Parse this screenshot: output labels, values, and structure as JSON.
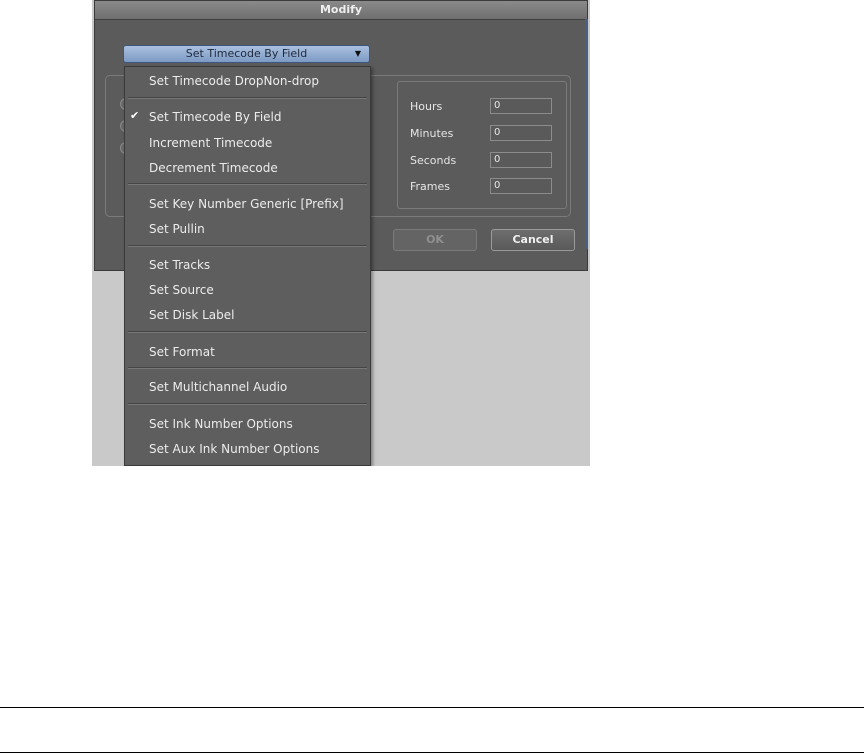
{
  "dialog": {
    "title": "Modify",
    "dropdown_value": "Set Timecode By Field",
    "fields": [
      {
        "label": "Hours",
        "value": "0"
      },
      {
        "label": "Minutes",
        "value": "0"
      },
      {
        "label": "Seconds",
        "value": "0"
      },
      {
        "label": "Frames",
        "value": "0"
      }
    ],
    "ok_label": "OK",
    "cancel_label": "Cancel"
  },
  "menu": {
    "items": [
      "Set Timecode DropNon-drop",
      "Set Timecode By Field",
      "Increment Timecode",
      "Decrement Timecode",
      "Set Key Number Generic [Prefix]",
      "Set Pullin",
      "Set Tracks",
      "Set Source",
      "Set Disk Label",
      "Set Format",
      "Set Multichannel Audio",
      "Set Ink Number Options",
      "Set Aux Ink Number Options"
    ],
    "checked_item": "Set Timecode By Field"
  },
  "colors": {
    "dialog_bg": "#5b5b5b",
    "dropdown_accent": "#8fa9d0",
    "menu_bg": "#5e5e5e"
  }
}
